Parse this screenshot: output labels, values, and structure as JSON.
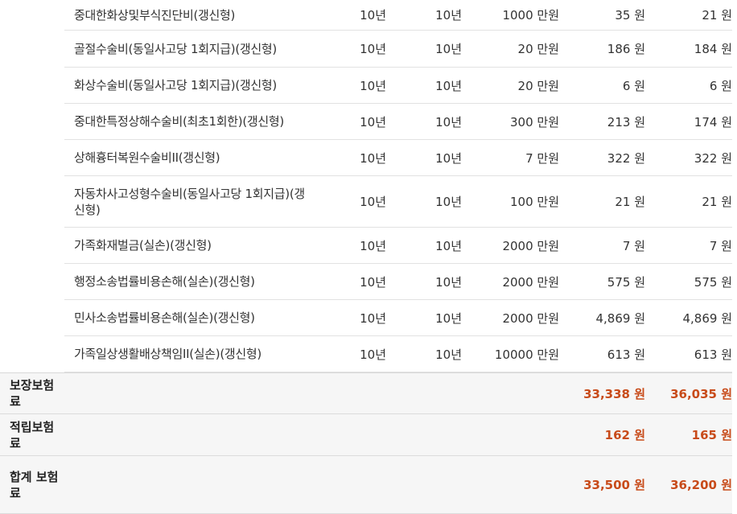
{
  "rows": [
    {
      "name": "중대한화상및부식진단비(갱신형)",
      "term": "10년",
      "pay": "10년",
      "amount": "1000 만원",
      "premium_a": "35 원",
      "premium_b": "21 원"
    },
    {
      "name": "골절수술비(동일사고당 1회지급)(갱신형)",
      "term": "10년",
      "pay": "10년",
      "amount": "20 만원",
      "premium_a": "186 원",
      "premium_b": "184 원"
    },
    {
      "name": "화상수술비(동일사고당 1회지급)(갱신형)",
      "term": "10년",
      "pay": "10년",
      "amount": "20 만원",
      "premium_a": "6 원",
      "premium_b": "6 원"
    },
    {
      "name": "중대한특정상해수술비(최초1회한)(갱신형)",
      "term": "10년",
      "pay": "10년",
      "amount": "300 만원",
      "premium_a": "213 원",
      "premium_b": "174 원"
    },
    {
      "name": "상해흉터복원수술비II(갱신형)",
      "term": "10년",
      "pay": "10년",
      "amount": "7 만원",
      "premium_a": "322 원",
      "premium_b": "322 원"
    },
    {
      "name": "자동차사고성형수술비(동일사고당 1회지급)(갱신형)",
      "term": "10년",
      "pay": "10년",
      "amount": "100 만원",
      "premium_a": "21 원",
      "premium_b": "21 원"
    },
    {
      "name": "가족화재벌금(실손)(갱신형)",
      "term": "10년",
      "pay": "10년",
      "amount": "2000 만원",
      "premium_a": "7 원",
      "premium_b": "7 원"
    },
    {
      "name": "행정소송법률비용손해(실손)(갱신형)",
      "term": "10년",
      "pay": "10년",
      "amount": "2000 만원",
      "premium_a": "575 원",
      "premium_b": "575 원"
    },
    {
      "name": "민사소송법률비용손해(실손)(갱신형)",
      "term": "10년",
      "pay": "10년",
      "amount": "2000 만원",
      "premium_a": "4,869 원",
      "premium_b": "4,869 원"
    },
    {
      "name": "가족일상생활배상책임II(실손)(갱신형)",
      "term": "10년",
      "pay": "10년",
      "amount": "10000 만원",
      "premium_a": "613 원",
      "premium_b": "613 원"
    }
  ],
  "summary": [
    {
      "label": "보장보험료",
      "premium_a": "33,338 원",
      "premium_b": "36,035 원"
    },
    {
      "label": "적립보험료",
      "premium_a": "162 원",
      "premium_b": "165 원"
    },
    {
      "label": "합계 보험료",
      "premium_a": "33,500 원",
      "premium_b": "36,200 원"
    }
  ],
  "colors": {
    "accent": "#c84b1a",
    "summary_bg": "#f6f6f6",
    "border": "#e2e2e2"
  }
}
